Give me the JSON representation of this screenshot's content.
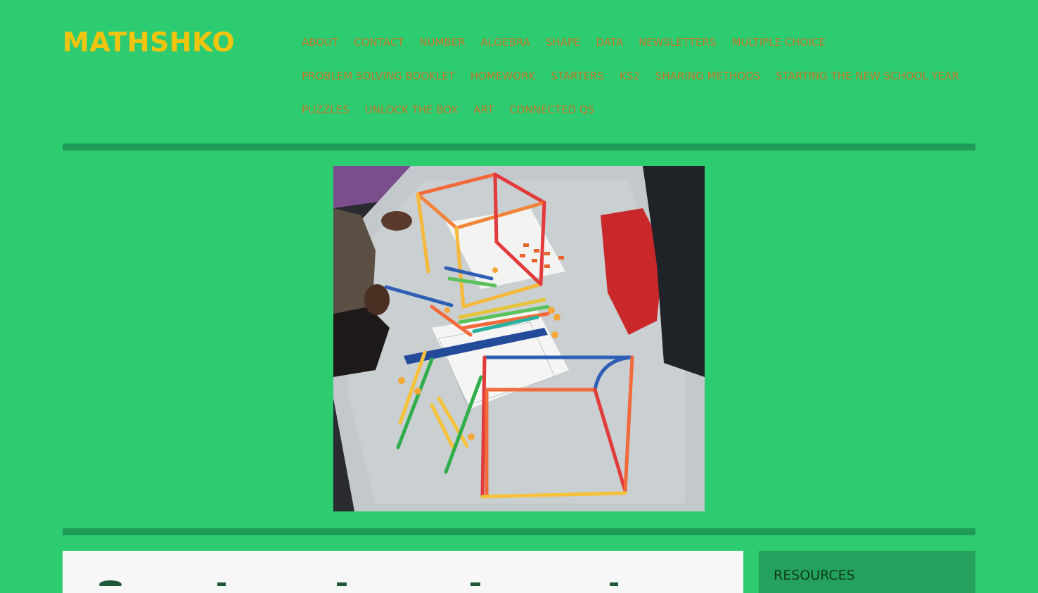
{
  "site": {
    "title": "MATHSHKO"
  },
  "nav": {
    "rows": [
      [
        "ABOUT",
        "CONTACT",
        "NUMBER",
        "ALGEBRA",
        "SHAPE",
        "DATA",
        "NEWSLETTERS",
        "MULTIPLE CHOICE"
      ],
      [
        "PROBLEM SOLVING BOOKLET",
        "HOMEWORK",
        "STARTERS",
        "KS2",
        "SHARING METHODS",
        "STARTING THE NEW SCHOOL YEAR"
      ],
      [
        "PUZZLES",
        "UNLOCK THE BOX",
        "ART",
        "CONNECTED QS"
      ]
    ]
  },
  "sidebar": {
    "widget_title": "RESOURCES"
  },
  "colors": {
    "background": "#2ecc71",
    "title": "#f1c40f",
    "nav_link": "#c0762a",
    "divider": "#1e9b58",
    "widget_bg": "#24a15c"
  }
}
